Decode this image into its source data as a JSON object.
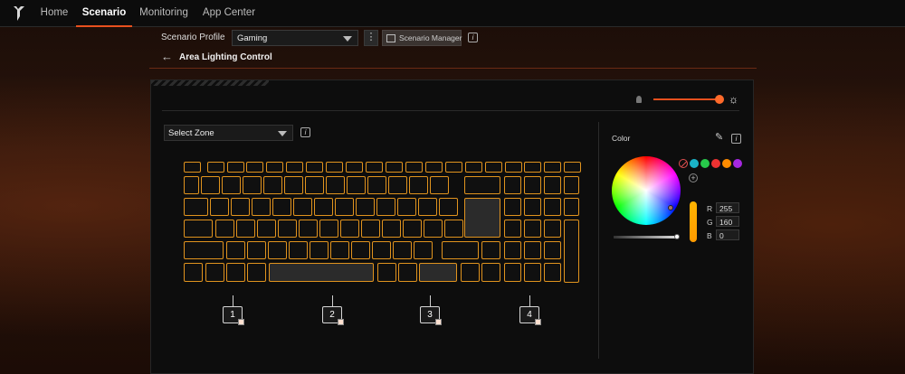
{
  "nav": {
    "items": [
      "Home",
      "Scenario",
      "Monitoring",
      "App Center"
    ],
    "active": "Scenario"
  },
  "profile": {
    "label": "Scenario Profile",
    "selected": "Gaming",
    "manager_label": "Scenario Manager"
  },
  "page": {
    "title": "Area Lighting Control",
    "back_glyph": "←"
  },
  "zone_select": {
    "placeholder": "Select Zone"
  },
  "brightness": {
    "level_percent": 100
  },
  "zones": [
    "1",
    "2",
    "3",
    "4"
  ],
  "color": {
    "title": "Color",
    "presets": [
      "#1ab3c8",
      "#27c94a",
      "#ee3232",
      "#ff8c00",
      "#a628e0"
    ],
    "r_label": "R",
    "g_label": "G",
    "b_label": "B",
    "r": "255",
    "g": "160",
    "b": "0",
    "accent": "#e8501e",
    "key_outline": "#e0931e"
  },
  "icons": {
    "logo": "predator-logo-icon",
    "more": "more-vertical-icon",
    "info": "info-icon",
    "back": "back-arrow-icon",
    "eyedropper": "eyedropper-icon",
    "bulb_low": "bulb-dim-icon",
    "bulb_high": "bulb-bright-icon"
  },
  "glyphs": {
    "more": "⋮",
    "info": "i",
    "bulb": "☼",
    "add": "+",
    "eyedropper": "✎"
  }
}
